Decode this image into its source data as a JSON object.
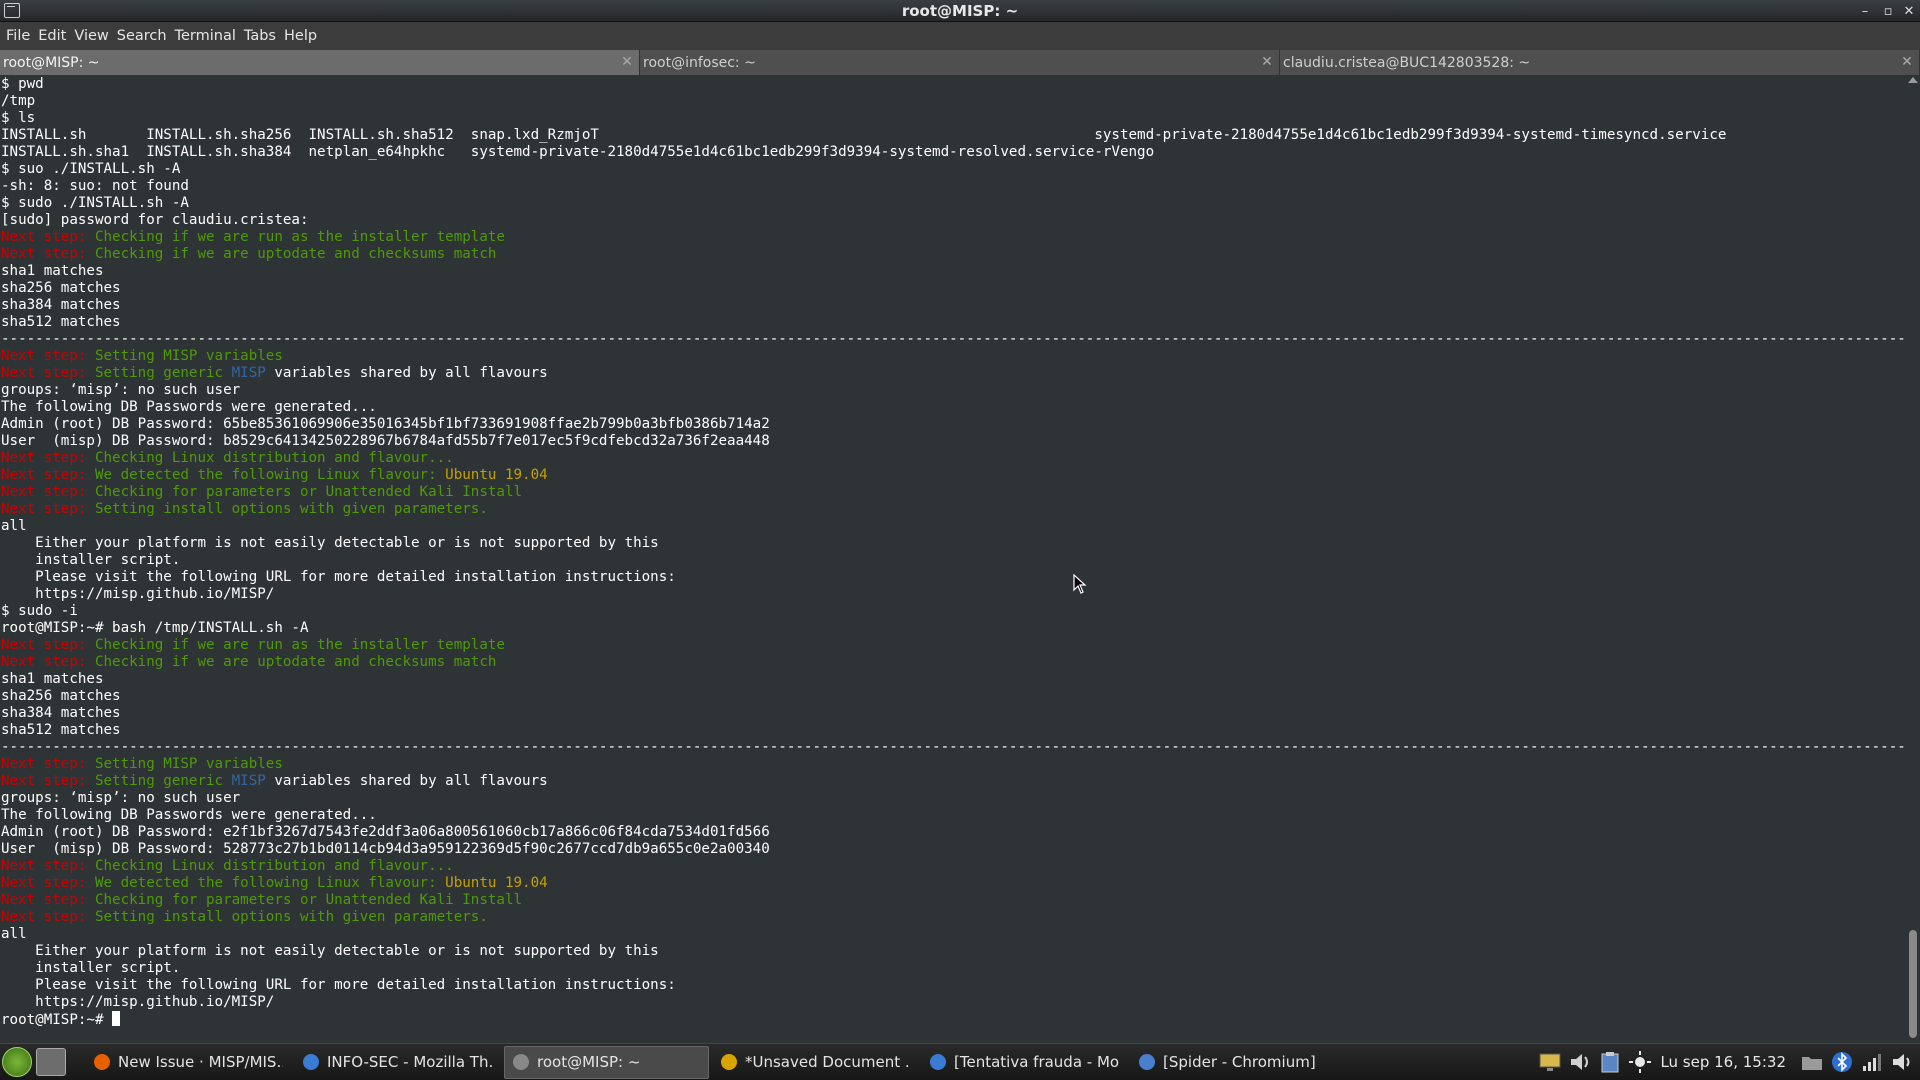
{
  "window": {
    "title": "root@MISP: ~"
  },
  "menu": [
    "File",
    "Edit",
    "View",
    "Search",
    "Terminal",
    "Tabs",
    "Help"
  ],
  "tabs": [
    {
      "label": "root@MISP: ~",
      "active": true
    },
    {
      "label": "root@infosec: ~",
      "active": false
    },
    {
      "label": "claudiu.cristea@BUC142803528: ~",
      "active": false
    }
  ],
  "terminal_lines": [
    [
      {
        "t": "$ pwd"
      }
    ],
    [
      {
        "t": "/tmp"
      }
    ],
    [
      {
        "t": "$ ls"
      }
    ],
    [
      {
        "t": "INSTALL.sh       INSTALL.sh.sha256  INSTALL.sh.sha512  snap.lxd_RzmjoT                                                          systemd-private-2180d4755e1d4c61bc1edb299f3d9394-systemd-timesyncd.service"
      }
    ],
    [
      {
        "t": "INSTALL.sh.sha1  INSTALL.sh.sha384  netplan_e64hpkhc   systemd-private-2180d4755e1d4c61bc1edb299f3d9394-systemd-resolved.service-rVengo"
      }
    ],
    [
      {
        "t": "$ suo ./INSTALL.sh -A"
      }
    ],
    [
      {
        "t": "-sh: 8: suo: not found"
      }
    ],
    [
      {
        "t": "$ sudo ./INSTALL.sh -A"
      }
    ],
    [
      {
        "t": "[sudo] password for claudiu.cristea:"
      }
    ],
    [
      {
        "t": "Next step:",
        "c": "red"
      },
      {
        "t": " Checking if we are run as the installer template",
        "c": "green"
      }
    ],
    [
      {
        "t": "Next step:",
        "c": "red"
      },
      {
        "t": " Checking if we are uptodate and checksums match",
        "c": "green"
      }
    ],
    [
      {
        "t": "sha1 matches"
      }
    ],
    [
      {
        "t": "sha256 matches"
      }
    ],
    [
      {
        "t": "sha384 matches"
      }
    ],
    [
      {
        "t": "sha512 matches"
      }
    ],
    [
      {
        "t": "----------------------------------------------------------------------------------------------------------------------------------------------------------------------------------------------------------------------------------------------------------------"
      }
    ],
    [
      {
        "t": "Next step:",
        "c": "red"
      },
      {
        "t": " Setting MISP variables",
        "c": "green"
      }
    ],
    [
      {
        "t": "Next step:",
        "c": "red"
      },
      {
        "t": " Setting generic ",
        "c": "green"
      },
      {
        "t": "MISP",
        "c": "blue"
      },
      {
        "t": " variables shared by all flavours"
      }
    ],
    [
      {
        "t": "groups: ‘misp’: no such user"
      }
    ],
    [
      {
        "t": "The following DB Passwords were generated..."
      }
    ],
    [
      {
        "t": "Admin (root) DB Password: 65be85361069906e35016345bf1bf733691908ffae2b799b0a3bfb0386b714a2"
      }
    ],
    [
      {
        "t": "User  (misp) DB Password: b8529c64134250228967b6784afd55b7f7e017ec5f9cdfebcd32a736f2eaa448"
      }
    ],
    [
      {
        "t": "Next step:",
        "c": "red"
      },
      {
        "t": " Checking Linux distribution and flavour...",
        "c": "green"
      }
    ],
    [
      {
        "t": "Next step:",
        "c": "red"
      },
      {
        "t": " We detected the following Linux flavour: ",
        "c": "green"
      },
      {
        "t": "Ubuntu 19.04",
        "c": "yellow"
      }
    ],
    [
      {
        "t": "Next step:",
        "c": "red"
      },
      {
        "t": " Checking for parameters or Unattended Kali Install",
        "c": "green"
      }
    ],
    [
      {
        "t": "Next step:",
        "c": "red"
      },
      {
        "t": " Setting install options with given parameters.",
        "c": "green"
      }
    ],
    [
      {
        "t": "all"
      }
    ],
    [
      {
        "t": "    Either your platform is not easily detectable or is not supported by this"
      }
    ],
    [
      {
        "t": "    installer script."
      }
    ],
    [
      {
        "t": "    Please visit the following URL for more detailed installation instructions:"
      }
    ],
    [
      {
        "t": "    https://misp.github.io/MISP/"
      }
    ],
    [
      {
        "t": "$ sudo -i"
      }
    ],
    [
      {
        "t": "root@MISP:~# bash /tmp/INSTALL.sh -A"
      }
    ],
    [
      {
        "t": "Next step:",
        "c": "red"
      },
      {
        "t": " Checking if we are run as the installer template",
        "c": "green"
      }
    ],
    [
      {
        "t": "Next step:",
        "c": "red"
      },
      {
        "t": " Checking if we are uptodate and checksums match",
        "c": "green"
      }
    ],
    [
      {
        "t": "sha1 matches"
      }
    ],
    [
      {
        "t": "sha256 matches"
      }
    ],
    [
      {
        "t": "sha384 matches"
      }
    ],
    [
      {
        "t": "sha512 matches"
      }
    ],
    [
      {
        "t": "----------------------------------------------------------------------------------------------------------------------------------------------------------------------------------------------------------------------------------------------------------------"
      }
    ],
    [
      {
        "t": "Next step:",
        "c": "red"
      },
      {
        "t": " Setting MISP variables",
        "c": "green"
      }
    ],
    [
      {
        "t": "Next step:",
        "c": "red"
      },
      {
        "t": " Setting generic ",
        "c": "green"
      },
      {
        "t": "MISP",
        "c": "blue"
      },
      {
        "t": " variables shared by all flavours"
      }
    ],
    [
      {
        "t": "groups: ‘misp’: no such user"
      }
    ],
    [
      {
        "t": "The following DB Passwords were generated..."
      }
    ],
    [
      {
        "t": "Admin (root) DB Password: e2f1bf3267d7543fe2ddf3a06a800561060cb17a866c06f84cda7534d01fd566"
      }
    ],
    [
      {
        "t": "User  (misp) DB Password: 528773c27b1bd0114cb94d3a959122369d5f90c2677ccd7db9a655c0e2a00340"
      }
    ],
    [
      {
        "t": "Next step:",
        "c": "red"
      },
      {
        "t": " Checking Linux distribution and flavour...",
        "c": "green"
      }
    ],
    [
      {
        "t": "Next step:",
        "c": "red"
      },
      {
        "t": " We detected the following Linux flavour: ",
        "c": "green"
      },
      {
        "t": "Ubuntu 19.04",
        "c": "yellow"
      }
    ],
    [
      {
        "t": "Next step:",
        "c": "red"
      },
      {
        "t": " Checking for parameters or Unattended Kali Install",
        "c": "green"
      }
    ],
    [
      {
        "t": "Next step:",
        "c": "red"
      },
      {
        "t": " Setting install options with given parameters.",
        "c": "green"
      }
    ],
    [
      {
        "t": "all"
      }
    ],
    [
      {
        "t": "    Either your platform is not easily detectable or is not supported by this"
      }
    ],
    [
      {
        "t": "    installer script."
      }
    ],
    [
      {
        "t": "    Please visit the following URL for more detailed installation instructions:"
      }
    ],
    [
      {
        "t": "    https://misp.github.io/MISP/"
      }
    ],
    [
      {
        "t": "root@MISP:~# "
      },
      {
        "cursor": true
      }
    ]
  ],
  "colors": {
    "red": "#cc0000",
    "green": "#4e9a06",
    "blue": "#3465a4",
    "yellow": "#c4a000",
    "terminal_bg": "#2e3436"
  },
  "taskbar": {
    "tasks": [
      {
        "label": "New Issue · MISP/MIS...",
        "icon": "firefox-icon",
        "color": "#e66000",
        "active": false
      },
      {
        "label": "INFO-SEC - Mozilla Th...",
        "icon": "thunderbird-icon",
        "color": "#3a7bd5",
        "active": false
      },
      {
        "label": "root@MISP: ~",
        "icon": "terminal-icon",
        "color": "#888888",
        "active": true
      },
      {
        "label": "*Unsaved Document ...",
        "icon": "text-editor-icon",
        "color": "#d9a300",
        "active": false
      },
      {
        "label": "[Tentativa frauda - Mo...",
        "icon": "thunderbird-icon",
        "color": "#3a7bd5",
        "active": false
      },
      {
        "label": "[Spider - Chromium]",
        "icon": "chromium-icon",
        "color": "#4a7fd0",
        "active": false
      }
    ],
    "clock": "Lu sep 16, 15:32"
  }
}
